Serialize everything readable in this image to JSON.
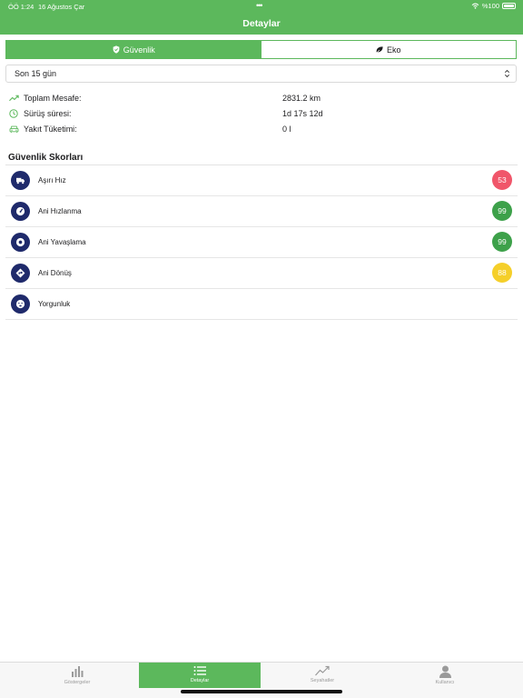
{
  "status_bar": {
    "time": "ÖÖ 1:24",
    "date": "16 Ağustos Çar",
    "battery": "%100"
  },
  "nav": {
    "title": "Detaylar"
  },
  "segments": [
    {
      "label": "Güvenlik",
      "icon": "shield-icon",
      "active": true
    },
    {
      "label": "Eko",
      "icon": "leaf-icon",
      "active": false
    }
  ],
  "period": {
    "selected": "Son 15 gün"
  },
  "stats": [
    {
      "label": "Toplam Mesafe:",
      "value": "2831.2 km",
      "icon": "trending-up-icon"
    },
    {
      "label": "Sürüş süresi:",
      "value": "1d 17s 12d",
      "icon": "clock-icon"
    },
    {
      "label": "Yakıt Tüketimi:",
      "value": "0 l",
      "icon": "car-icon"
    }
  ],
  "scores_title": "Güvenlik Skorları",
  "scores": [
    {
      "label": "Aşırı Hız",
      "value": "53",
      "color": "#f0566a",
      "icon": "truck-speed-icon"
    },
    {
      "label": "Ani Hızlanma",
      "value": "99",
      "color": "#3da14a",
      "icon": "speedometer-icon"
    },
    {
      "label": "Ani Yavaşlama",
      "value": "99",
      "color": "#3da14a",
      "icon": "brake-disc-icon"
    },
    {
      "label": "Ani Dönüş",
      "value": "88",
      "color": "#f5cf2a",
      "icon": "turn-sign-icon"
    },
    {
      "label": "Yorgunluk",
      "value": "",
      "color": "",
      "icon": "tired-face-icon"
    }
  ],
  "tabs": [
    {
      "label": "Göstergeler",
      "icon": "bar-chart-icon",
      "active": false
    },
    {
      "label": "Detaylar",
      "icon": "list-icon",
      "active": true
    },
    {
      "label": "Seyahatler",
      "icon": "trend-line-icon",
      "active": false
    },
    {
      "label": "Kullanıcı",
      "icon": "user-icon",
      "active": false
    }
  ],
  "colors": {
    "accent": "#5cb85c",
    "score_icon_bg": "#1f2a6b"
  }
}
